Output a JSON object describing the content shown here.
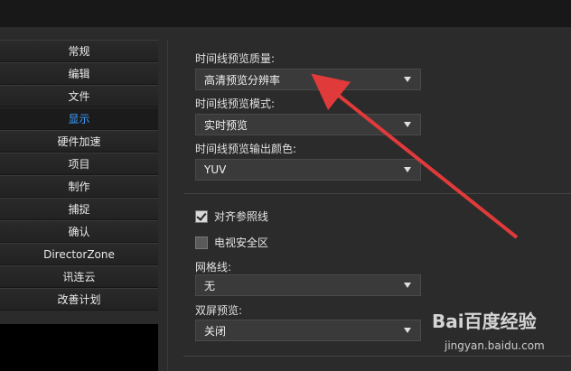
{
  "sidebar": {
    "items": [
      {
        "label": "常规",
        "active": false
      },
      {
        "label": "编辑",
        "active": false
      },
      {
        "label": "文件",
        "active": false
      },
      {
        "label": "显示",
        "active": true
      },
      {
        "label": "硬件加速",
        "active": false
      },
      {
        "label": "项目",
        "active": false
      },
      {
        "label": "制作",
        "active": false
      },
      {
        "label": "捕捉",
        "active": false
      },
      {
        "label": "确认",
        "active": false
      },
      {
        "label": "DirectorZone",
        "active": false
      },
      {
        "label": "讯连云",
        "active": false
      },
      {
        "label": "改善计划",
        "active": false
      }
    ]
  },
  "settings": {
    "preview_quality": {
      "label": "时间线预览质量:",
      "value": "高清预览分辨率"
    },
    "preview_mode": {
      "label": "时间线预览模式:",
      "value": "实时预览"
    },
    "output_color": {
      "label": "时间线预览输出颜色:",
      "value": "YUV"
    },
    "align_guides": {
      "label": "对齐参照线",
      "checked": true
    },
    "tv_safe_zone": {
      "label": "电视安全区",
      "checked": false
    },
    "grid_lines": {
      "label": "网格线:",
      "value": "无"
    },
    "dual_preview": {
      "label": "双屏预览:",
      "value": "关闭"
    }
  },
  "watermark": {
    "logo": "Bai百度经验",
    "sub": "jingyan.baidu.com"
  },
  "colors": {
    "accent": "#3fa0ff",
    "annotation_arrow": "#e03a3a"
  }
}
